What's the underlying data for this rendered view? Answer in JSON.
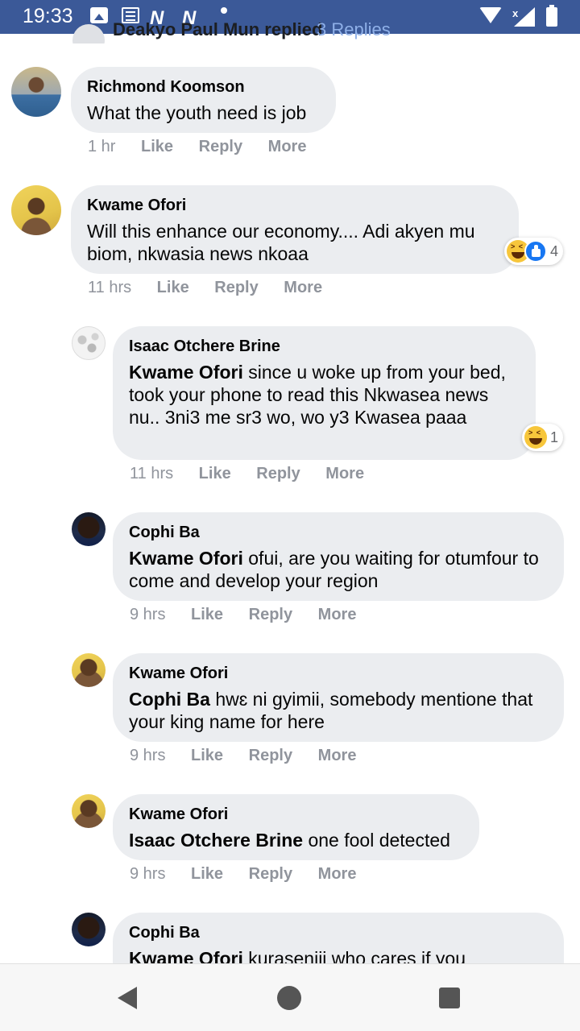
{
  "status_bar": {
    "time": "19:33",
    "icons": [
      "gallery-icon",
      "news-icon",
      "notification-n-icon",
      "notification-n-icon",
      "dot-icon",
      "wifi-icon",
      "signal-icon",
      "battery-icon"
    ],
    "n1": "N",
    "n2": "N",
    "x_mark": "x"
  },
  "previous": {
    "text": "Deakyo Paul Mun replied",
    "count": "3 Replies"
  },
  "comments": [
    {
      "author": "Richmond Koomson",
      "mention": "",
      "text": "What the youth need is job",
      "time": "1 hr",
      "like": "Like",
      "reply": "Reply",
      "more": "More"
    },
    {
      "author": "Kwame Ofori",
      "mention": "",
      "text": "Will this enhance our economy.... Adi akyen mu biom, nkwasia news nkoaa",
      "time": "11 hrs",
      "like": "Like",
      "reply": "Reply",
      "more": "More",
      "reaction_count": "4"
    },
    {
      "author": "Isaac Otchere Brine",
      "mention": "Kwame Ofori",
      "text": " since u woke up from your bed, took your phone to read this Nkwasea news nu.. 3ni3 me sr3 wo, wo y3 Kwasea paaa",
      "time": "11 hrs",
      "like": "Like",
      "reply": "Reply",
      "more": "More",
      "reaction_count": "1"
    },
    {
      "author": "Cophi Ba",
      "mention": "Kwame Ofori",
      "text": " ofui, are you waiting for otumfour to come and develop your region",
      "time": "9 hrs",
      "like": "Like",
      "reply": "Reply",
      "more": "More"
    },
    {
      "author": "Kwame Ofori",
      "mention": "Cophi Ba",
      "text": " hwɛ ni gyimii, somebody mentione that your king name for here",
      "time": "9 hrs",
      "like": "Like",
      "reply": "Reply",
      "more": "More"
    },
    {
      "author": "Kwame Ofori",
      "mention": "Isaac Otchere Brine",
      "text": " one fool detected",
      "time": "9 hrs",
      "like": "Like",
      "reply": "Reply",
      "more": "More"
    },
    {
      "author": "Cophi Ba",
      "mention": "Kwame Ofori",
      "text": " kuraseniii who cares if you",
      "time": "",
      "like": "",
      "reply": "",
      "more": ""
    }
  ],
  "colors": {
    "status_bar": "#3b5998",
    "bubble": "#ebedf0",
    "meta_text": "#90949c"
  }
}
